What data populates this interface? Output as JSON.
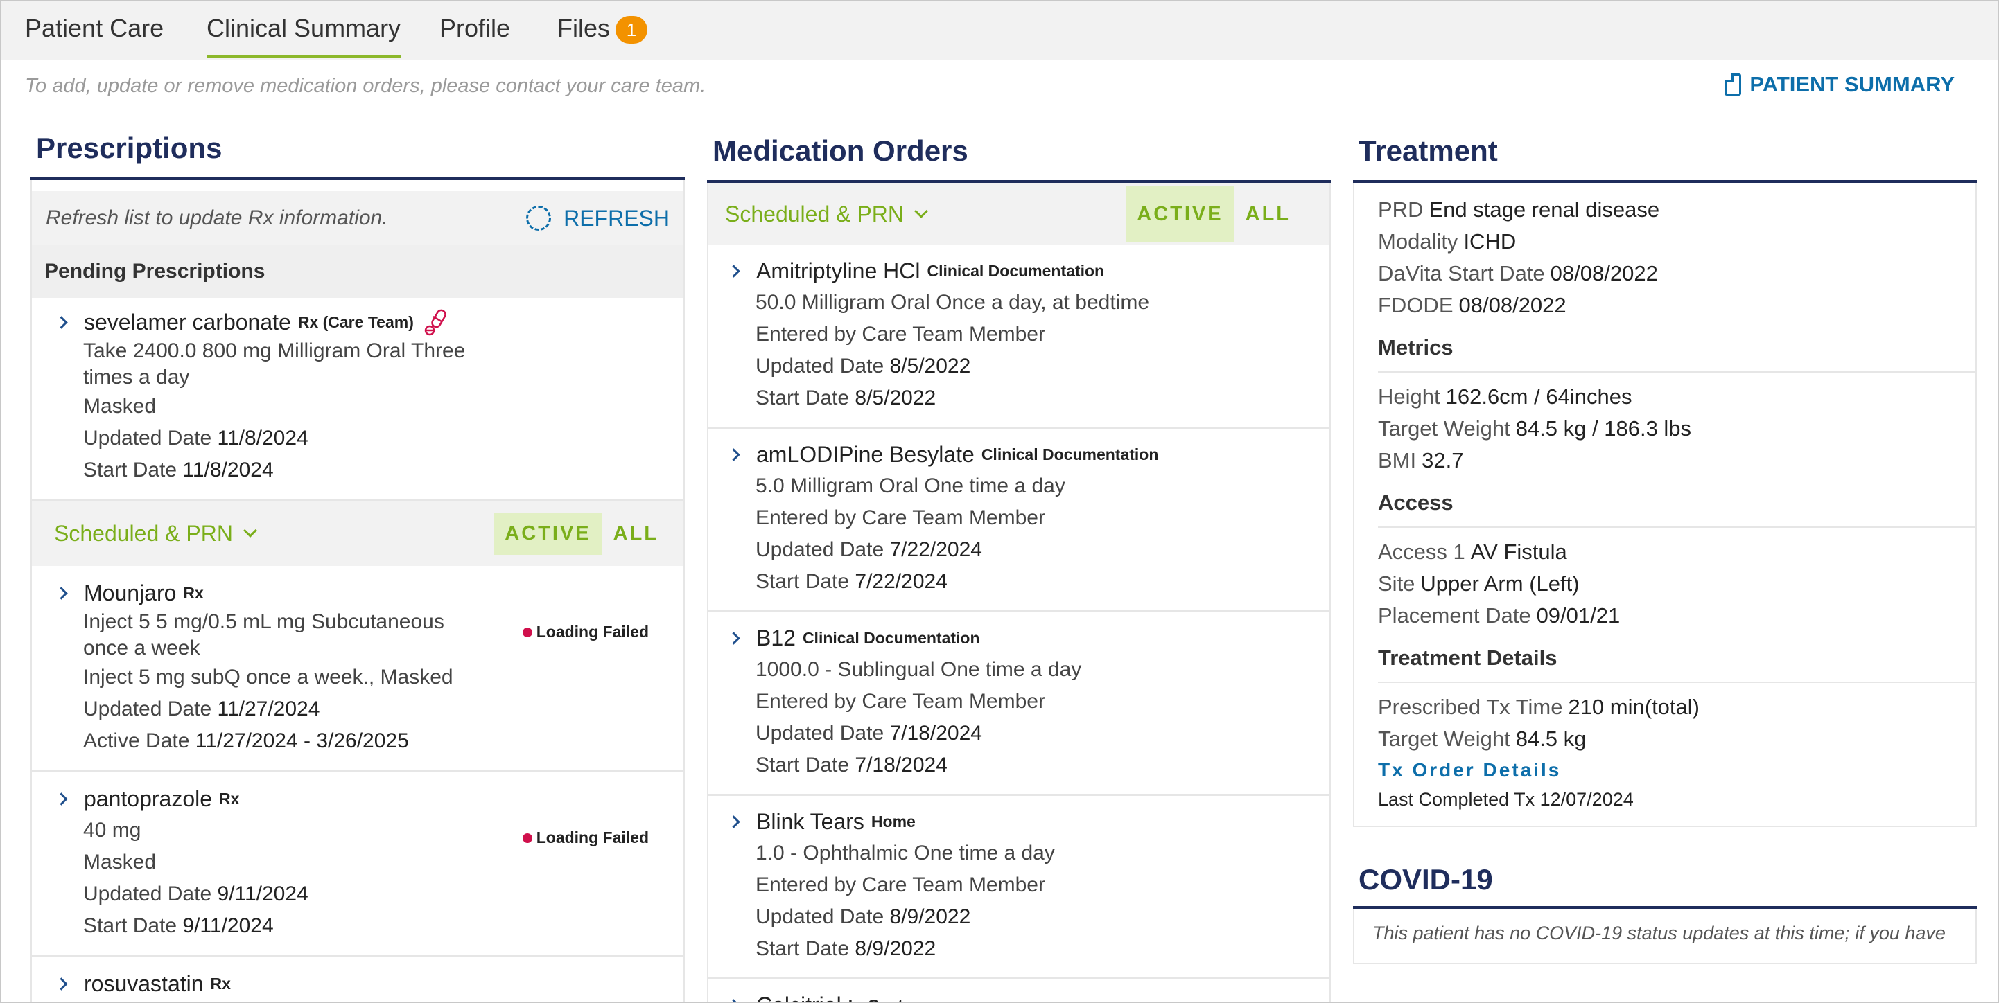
{
  "tabs": {
    "patient_care": "Patient Care",
    "clinical_summary": "Clinical Summary",
    "profile": "Profile",
    "files": "Files",
    "files_badge": "1"
  },
  "notice": "To add, update or remove medication orders, please contact your care team.",
  "patient_summary_label": "PATIENT SUMMARY",
  "prescriptions": {
    "title": "Prescriptions",
    "refresh_hint": "Refresh list to update Rx information.",
    "refresh_label": "REFRESH",
    "pending_head": "Pending Prescriptions",
    "pending": {
      "name": "sevelamer carbonate",
      "tag": "Rx (Care Team)",
      "line1": "Take 2400.0 800 mg Milligram Oral Three",
      "line2": "times a day",
      "line3": "Masked",
      "updated_label": "Updated Date",
      "updated": "11/8/2024",
      "start_label": "Start Date",
      "start": "11/8/2024"
    },
    "filter_label": "Scheduled & PRN",
    "active_label": "ACTIVE",
    "all_label": "ALL",
    "items": [
      {
        "name": "Mounjaro",
        "tag": "Rx",
        "line1": "Inject 5 5 mg/0.5 mL mg Subcutaneous",
        "line2": "once a week",
        "line3": "Inject 5 mg subQ once a week., Masked",
        "updated_label": "Updated Date",
        "updated": "11/27/2024",
        "date2_label": "Active Date",
        "date2": "11/27/2024 - 3/26/2025",
        "status": "Loading Failed"
      },
      {
        "name": "pantoprazole",
        "tag": "Rx",
        "line1": "40 mg",
        "line3": "Masked",
        "updated_label": "Updated Date",
        "updated": "9/11/2024",
        "date2_label": "Start Date",
        "date2": "9/11/2024",
        "status": "Loading Failed"
      },
      {
        "name": "rosuvastatin",
        "tag": "Rx"
      }
    ]
  },
  "medication_orders": {
    "title": "Medication Orders",
    "filter_label": "Scheduled & PRN",
    "active_label": "ACTIVE",
    "all_label": "ALL",
    "items": [
      {
        "name": "Amitriptyline HCl",
        "tag": "Clinical Documentation",
        "line1": "50.0 Milligram Oral Once a day, at bedtime",
        "line2": "Entered by Care Team Member",
        "updated_label": "Updated Date",
        "updated": "8/5/2022",
        "start_label": "Start Date",
        "start": "8/5/2022"
      },
      {
        "name": "amLODIPine Besylate",
        "tag": "Clinical Documentation",
        "line1": "5.0 Milligram Oral One time a day",
        "line2": "Entered by Care Team Member",
        "updated_label": "Updated Date",
        "updated": "7/22/2024",
        "start_label": "Start Date",
        "start": "7/22/2024"
      },
      {
        "name": "B12",
        "tag": "Clinical Documentation",
        "line1": "1000.0 - Sublingual One time a day",
        "line2": "Entered by Care Team Member",
        "updated_label": "Updated Date",
        "updated": "7/18/2024",
        "start_label": "Start Date",
        "start": "7/18/2024"
      },
      {
        "name": "Blink Tears",
        "tag": "Home",
        "line1": "1.0 - Ophthalmic One time a day",
        "line2": "Entered by Care Team Member",
        "updated_label": "Updated Date",
        "updated": "8/9/2022",
        "start_label": "Start Date",
        "start": "8/9/2022"
      },
      {
        "name": "Calcitriol",
        "tag": "In-Center"
      }
    ]
  },
  "treatment": {
    "title": "Treatment",
    "prd_label": "PRD",
    "prd": "End stage renal disease",
    "modality_label": "Modality",
    "modality": "ICHD",
    "start_label": "DaVita Start Date",
    "start": "08/08/2022",
    "fdode_label": "FDODE",
    "fdode": "08/08/2022",
    "metrics_head": "Metrics",
    "height_label": "Height",
    "height": "162.6cm / 64inches",
    "target_weight_label": "Target Weight",
    "target_weight": "84.5 kg / 186.3 lbs",
    "bmi_label": "BMI",
    "bmi": "32.7",
    "access_head": "Access",
    "access1_label": "Access 1",
    "access1": "AV Fistula",
    "site_label": "Site",
    "site": "Upper Arm (Left)",
    "placement_label": "Placement Date",
    "placement": "09/01/21",
    "details_head": "Treatment Details",
    "tx_time_label": "Prescribed Tx Time",
    "tx_time": "210 min(total)",
    "tx_weight_label": "Target Weight",
    "tx_weight": "84.5 kg",
    "tx_link": "Tx Order Details",
    "last_completed": "Last Completed Tx 12/07/2024"
  },
  "covid": {
    "title": "COVID-19",
    "text": "This patient has no COVID-19 status updates at this time; if you have"
  }
}
